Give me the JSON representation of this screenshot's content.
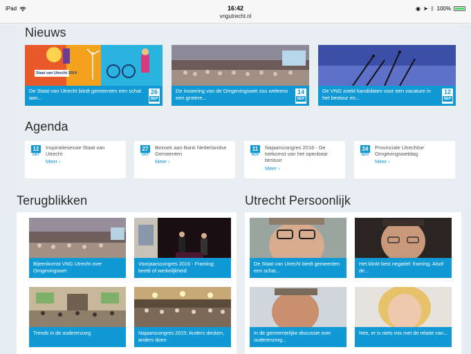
{
  "statusbar": {
    "device": "iPad",
    "time": "16:42",
    "url": "vngutrecht.nl",
    "battery": "100%"
  },
  "news": {
    "title": "Nieuws",
    "items": [
      {
        "caption": "De Staat van Utrecht biedt gemeenten een schat aan...",
        "day": "26",
        "month": "SEP",
        "image_label": "Staat van Utrecht 2014"
      },
      {
        "caption": "De invoering van de Omgevingswet zou weleens een grotere...",
        "day": "14",
        "month": "SEP"
      },
      {
        "caption": "De VNG zoekt kandidaten voor een vacature in het bestuur en...",
        "day": "12",
        "month": "SEP"
      }
    ]
  },
  "agenda": {
    "title": "Agenda",
    "more_label": "Meer ›",
    "items": [
      {
        "day": "12",
        "month": "OKT",
        "text": "Inspiratiesessie Staat van Utrecht"
      },
      {
        "day": "27",
        "month": "OKT",
        "text": "Bezoek aan Bank Nederlandse Gemeenten"
      },
      {
        "day": "11",
        "month": "NOV",
        "text": "Najaarscongres 2016 - De toekomst van het openbaar bestuur"
      },
      {
        "day": "24",
        "month": "NOV",
        "text": "Provinciale Utrechtse Omgevingswetdag"
      }
    ]
  },
  "terugblikken": {
    "title": "Terugblikken",
    "items": [
      {
        "caption": "Bijeenkomst VNG Utrecht over Omgevingswet"
      },
      {
        "caption": "Voorjaarscongres 2016 - Framing: beeld of werkelijkheid"
      },
      {
        "caption": "Trends in de ouderenzorg"
      },
      {
        "caption": "Najaarscongres 2015: Anders denken, anders doen"
      }
    ]
  },
  "persoonlijk": {
    "title": "Utrecht Persoonlijk",
    "items": [
      {
        "caption": "De Staat van Utrecht biedt gemeenten een schat..."
      },
      {
        "caption": "Het klinkt best negatief: framing. Alsof de..."
      },
      {
        "caption": "In de gemeentelijke discussie over ouderenzorg..."
      },
      {
        "caption": "Nee, er is niets mis met de relatie van..."
      }
    ]
  },
  "colors": {
    "accent": "#1199d6",
    "background": "#e9eef3"
  }
}
